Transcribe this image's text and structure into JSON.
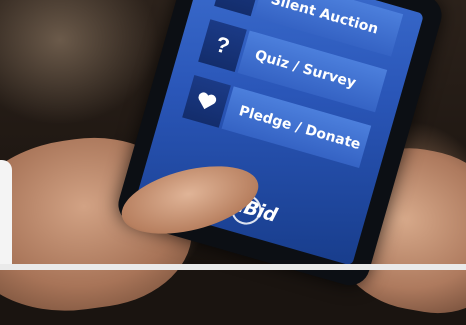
{
  "menu": {
    "items": [
      {
        "icon": "gavel-icon",
        "label": "Silent Auction"
      },
      {
        "icon": "question-mark-icon",
        "glyph": "?",
        "label": "Quiz / Survey"
      },
      {
        "icon": "heart-icon",
        "label": "Pledge / Donate"
      }
    ]
  },
  "logo": {
    "text": "iBid"
  },
  "colors": {
    "screen_top": "#3d6fd0",
    "screen_bottom": "#183d8c",
    "icon_box": "#1b3a86",
    "label_box": "#4c7fdc"
  }
}
